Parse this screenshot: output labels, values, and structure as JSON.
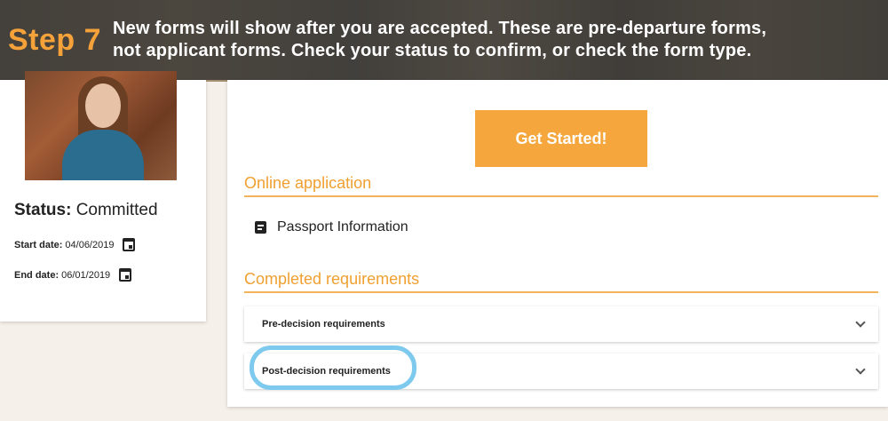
{
  "banner": {
    "step": "Step 7",
    "line1": "New forms will show after you are accepted. These are pre-departure forms,",
    "line2": "not applicant forms. Check your status to confirm, or check the form type."
  },
  "profile": {
    "status_label": "Status:",
    "status_value": "Committed",
    "start_label": "Start date:",
    "start_value": "04/06/2019",
    "end_label": "End date:",
    "end_value": "06/01/2019"
  },
  "main": {
    "get_started_label": "Get Started!",
    "online_application_title": "Online application",
    "passport_item": "Passport Information",
    "completed_title": "Completed requirements",
    "accordions": [
      {
        "label": "Pre-decision requirements"
      },
      {
        "label": "Post-decision requirements"
      }
    ]
  },
  "colors": {
    "accent_orange": "#f5a73d",
    "step_orange": "#f5a23a",
    "highlight_blue": "#7ec9ee"
  },
  "icons": [
    "calendar-icon",
    "document-icon",
    "chevron-down-icon"
  ]
}
